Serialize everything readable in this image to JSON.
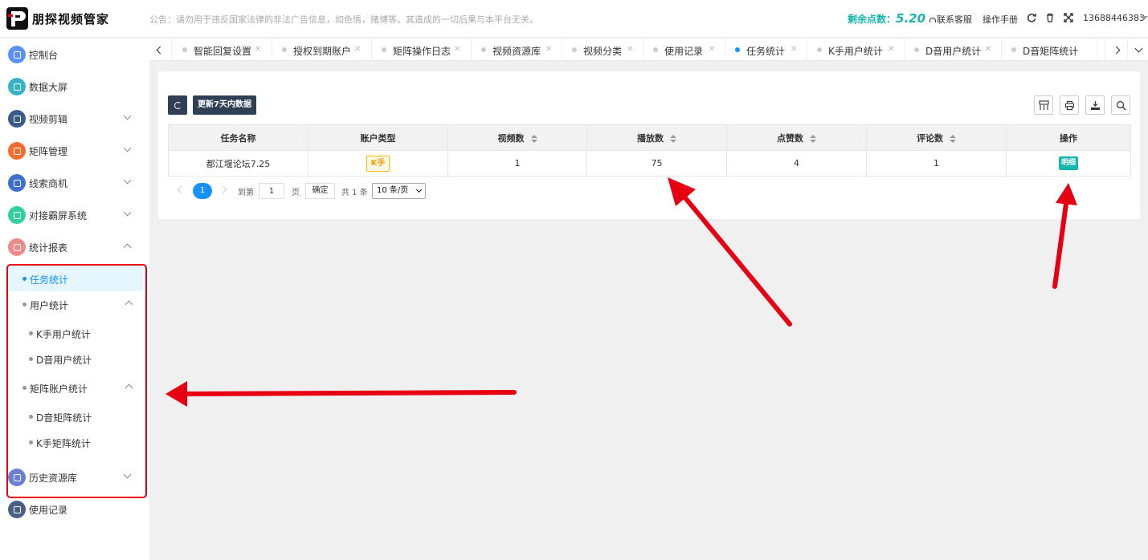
{
  "header": {
    "brand_name": "朋探视频管家",
    "notice": "公告：请勿用于违反国家法律的非法广告信息，如色情，赌博等。其造成的一切后果与本平台无关。",
    "points_label": "剩余点数：",
    "points_value": "5.20",
    "support_label": "联系客服",
    "manual_label": "操作手册",
    "user_phone": "13688446383"
  },
  "sidebar": {
    "items": [
      {
        "label": "控制台",
        "icon": "dashboard-icon",
        "color": "#5b8ff9"
      },
      {
        "label": "数据大屏",
        "icon": "screen-icon",
        "color": "#36b3c7"
      },
      {
        "label": "视频剪辑",
        "icon": "video-edit-icon",
        "color": "#3a5a8c"
      },
      {
        "label": "矩阵管理",
        "icon": "matrix-icon",
        "color": "#f56c2d"
      },
      {
        "label": "线索商机",
        "icon": "lead-icon",
        "color": "#3d6fd1"
      },
      {
        "label": "对接霸屏系统",
        "icon": "screen-system-icon",
        "color": "#2fcf9e"
      },
      {
        "label": "统计报表",
        "icon": "report-icon",
        "color": "#f08a8a"
      },
      {
        "label": "历史资源库",
        "icon": "history-icon",
        "color": "#6b7fd6"
      },
      {
        "label": "使用记录",
        "icon": "record-icon",
        "color": "#4a5f86"
      }
    ],
    "sub_items": {
      "task_stats": "任务统计",
      "user_stats": "用户统计",
      "k_user_stats": "K手用户统计",
      "d_user_stats": "D音用户统计",
      "matrix_stats": "矩阵账户统计",
      "d_matrix_stats": "D音矩阵统计",
      "k_matrix_stats": "K手矩阵统计"
    }
  },
  "tabs": [
    {
      "label": "智能回复设置"
    },
    {
      "label": "授权到期账户"
    },
    {
      "label": "矩阵操作日志"
    },
    {
      "label": "视频资源库"
    },
    {
      "label": "视频分类"
    },
    {
      "label": "使用记录"
    },
    {
      "label": "任务统计",
      "active": true
    },
    {
      "label": "K手用户统计"
    },
    {
      "label": "D音用户统计"
    },
    {
      "label": "D音矩阵统计"
    }
  ],
  "toolbar": {
    "update_label": "更新7天内数据"
  },
  "table": {
    "headers": [
      "任务名称",
      "账户类型",
      "视频数",
      "播放数",
      "点赞数",
      "评论数",
      "操作"
    ],
    "rows": [
      {
        "task_name": "都江堰论坛7.25",
        "account_type": "K手",
        "videos": "1",
        "plays": "75",
        "likes": "4",
        "comments": "1",
        "action": "明细"
      }
    ]
  },
  "pagination": {
    "current_page": "1",
    "goto_label": "到第",
    "page_input": "1",
    "page_unit": "页",
    "confirm_label": "确定",
    "total_label": "共 1 条",
    "page_size": "10 条/页"
  },
  "colors": {
    "accent": "#1890ff",
    "teal": "#16b6b0",
    "dark_button": "#2f4056",
    "annotation_red": "#e60012"
  }
}
